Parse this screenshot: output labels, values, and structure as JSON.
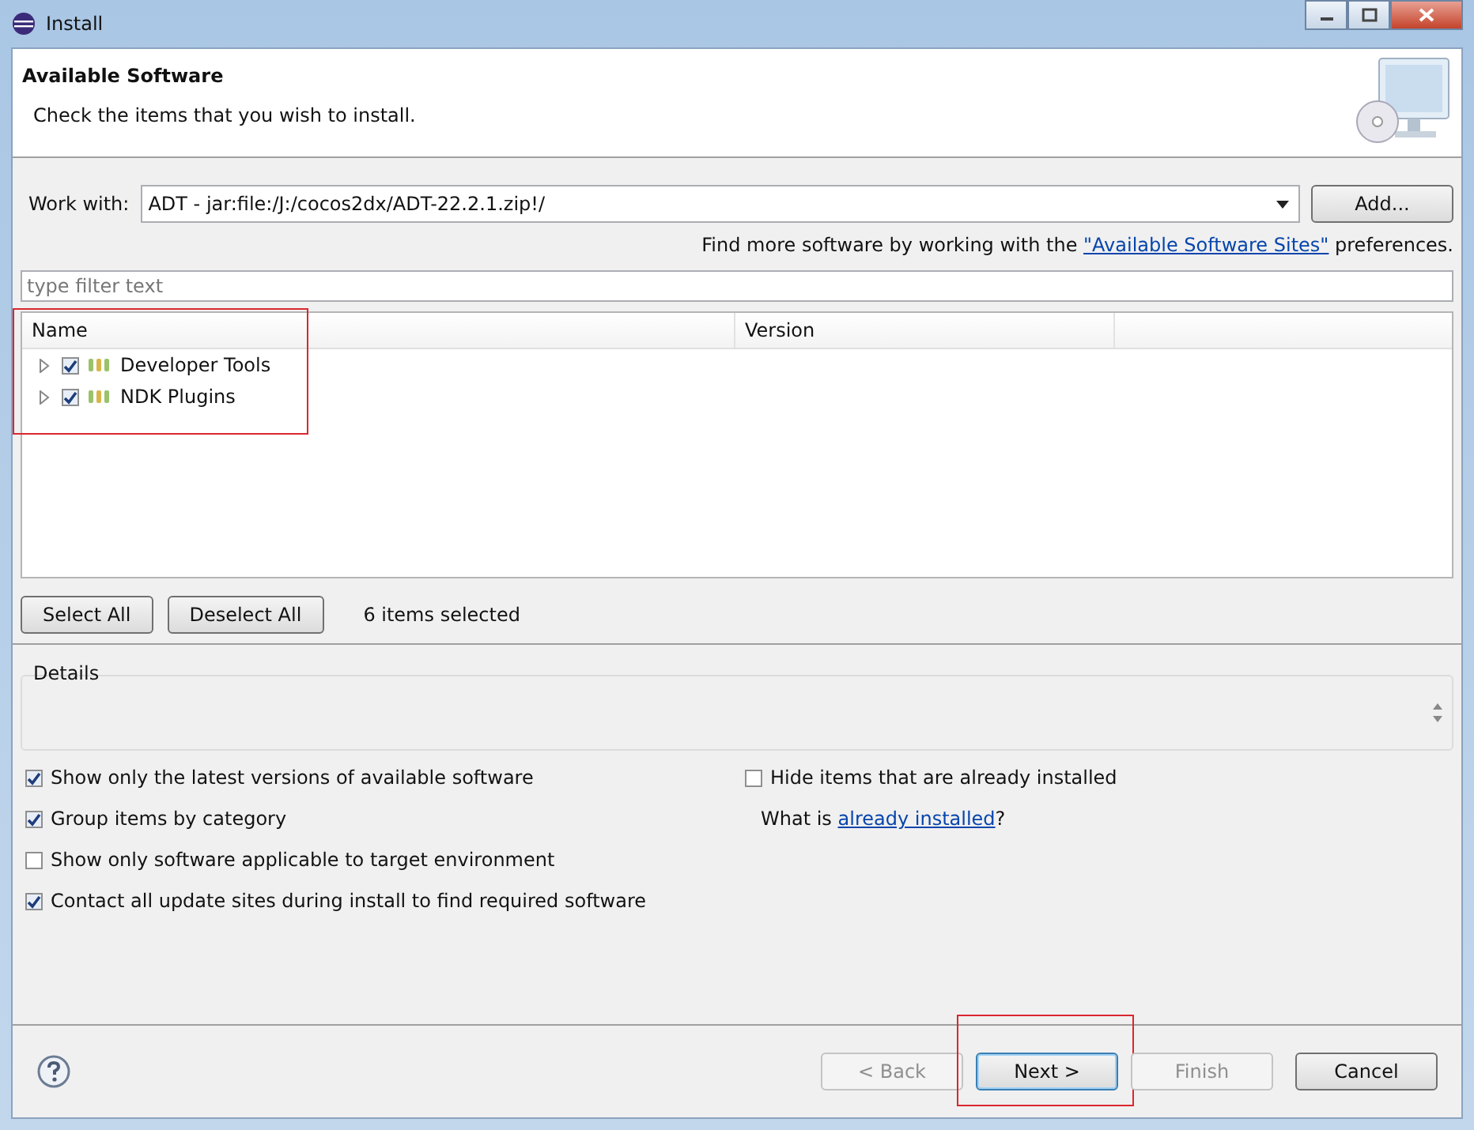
{
  "window": {
    "title": "Install"
  },
  "header": {
    "title": "Available Software",
    "subtitle": "Check the items that you wish to install."
  },
  "work_with": {
    "label": "Work with:",
    "value": "ADT - jar:file:/J:/cocos2dx/ADT-22.2.1.zip!/",
    "add_button": "Add..."
  },
  "more_sites": {
    "before": "Find more software by working with the",
    "link": "\"Available Software Sites\"",
    "after": "preferences."
  },
  "filter": {
    "placeholder": "type filter text"
  },
  "table": {
    "columns": [
      "Name",
      "Version"
    ],
    "highlighted": true,
    "rows": [
      {
        "name": "Developer Tools",
        "checked": true,
        "expanded": false
      },
      {
        "name": "NDK Plugins",
        "checked": true,
        "expanded": false
      }
    ]
  },
  "selection_buttons": [
    "Select All",
    "Deselect All"
  ],
  "selection_count": "6 items selected",
  "details": {
    "title": "Details"
  },
  "options_left": [
    {
      "label": "Show only the latest versions of available software",
      "checked": true
    },
    {
      "label": "Group items by category",
      "checked": true
    },
    {
      "label": "Show only software applicable to target environment",
      "checked": false
    },
    {
      "label": "Contact all update sites during install to find required software",
      "checked": true
    }
  ],
  "options_right": [
    {
      "label": "Hide items that are already installed",
      "checked": false
    }
  ],
  "installed_hint": {
    "before": "What is",
    "link": "already installed",
    "after": "?"
  },
  "footer_buttons": [
    {
      "label": "< Back",
      "disabled": true,
      "highlighted": false
    },
    {
      "label": "Next >",
      "disabled": false,
      "highlighted": true,
      "default": true
    },
    {
      "label": "Finish",
      "disabled": true,
      "highlighted": false
    },
    {
      "label": "Cancel",
      "disabled": false,
      "highlighted": false
    }
  ]
}
